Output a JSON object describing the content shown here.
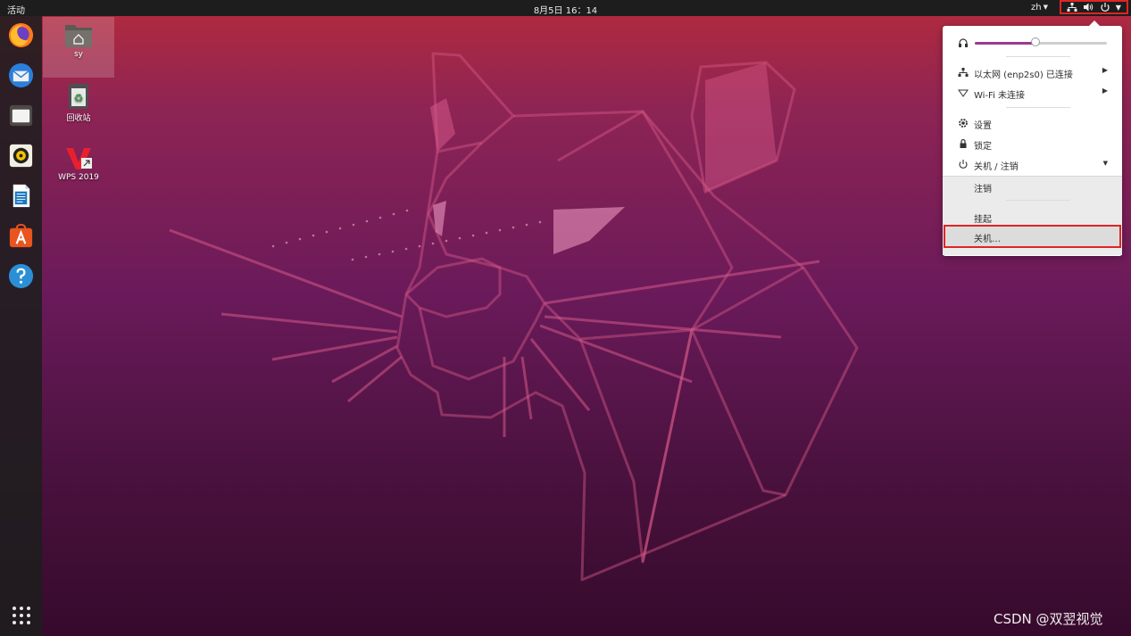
{
  "topbar": {
    "activities": "活动",
    "clock": "8月5日 16：14",
    "lang": "zh"
  },
  "dock": {
    "apps": [
      {
        "name": "firefox"
      },
      {
        "name": "thunderbird"
      },
      {
        "name": "files"
      },
      {
        "name": "rhythmbox"
      },
      {
        "name": "libreoffice-writer"
      },
      {
        "name": "ubuntu-software"
      },
      {
        "name": "help"
      }
    ]
  },
  "desktop": {
    "icons": [
      {
        "label": "sy"
      },
      {
        "label": "回收站"
      },
      {
        "label": "WPS 2019"
      }
    ]
  },
  "menu": {
    "volume": 0.46,
    "ethernet": "以太网 (enp2s0) 已连接",
    "wifi": "Wi-Fi 未连接",
    "settings": "设置",
    "lock": "锁定",
    "power_logout": "关机 / 注销",
    "logout": "注销",
    "suspend": "挂起",
    "poweroff": "关机…"
  },
  "watermark": "CSDN @双翌视觉",
  "colors": {
    "highlight_border": "#e02424",
    "accent": "#9a3a8e",
    "topbar": "#1d1d1d"
  }
}
